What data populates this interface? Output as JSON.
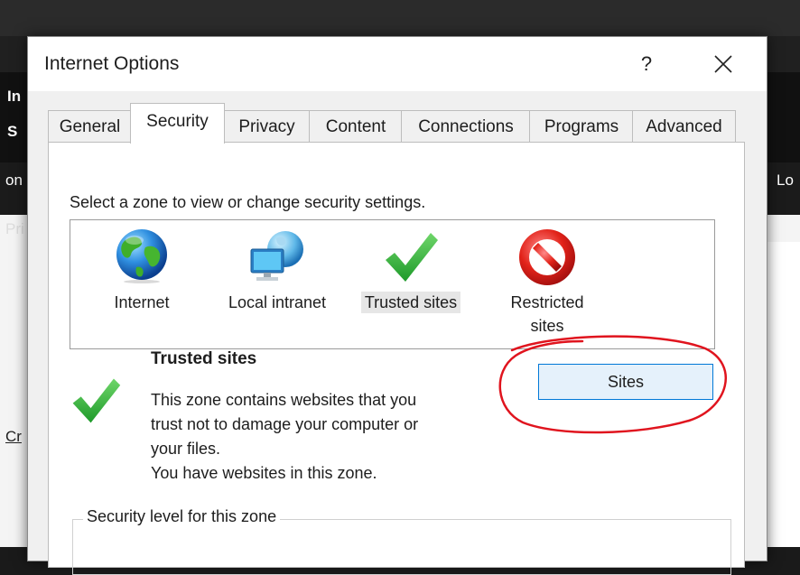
{
  "background": {
    "fragments": [
      "In",
      "S",
      "on",
      "Pri",
      "Cr",
      "Lo"
    ]
  },
  "dialog": {
    "title": "Internet Options",
    "help_label": "?",
    "close_label": "✕",
    "tabs": [
      {
        "label": "General",
        "active": false
      },
      {
        "label": "Security",
        "active": true
      },
      {
        "label": "Privacy",
        "active": false
      },
      {
        "label": "Content",
        "active": false
      },
      {
        "label": "Connections",
        "active": false
      },
      {
        "label": "Programs",
        "active": false
      },
      {
        "label": "Advanced",
        "active": false
      }
    ],
    "security": {
      "zone_prompt": "Select a zone to view or change security settings.",
      "zones": [
        {
          "label": "Internet",
          "icon": "globe-icon"
        },
        {
          "label": "Local intranet",
          "icon": "local-intranet-icon"
        },
        {
          "label": "Trusted sites",
          "icon": "checkmark-icon",
          "selected": true
        },
        {
          "label": "Restricted sites",
          "icon": "restricted-icon"
        }
      ],
      "selected_zone_title": "Trusted sites",
      "zone_description": [
        "This zone contains websites that you",
        "trust not to damage your computer or",
        "your files.",
        "You have websites in this zone."
      ],
      "sites_button": "Sites",
      "security_level_group_label": "Security level for this zone"
    },
    "annotation": {
      "shape": "hand-drawn ellipse",
      "color": "#e0141e"
    }
  }
}
